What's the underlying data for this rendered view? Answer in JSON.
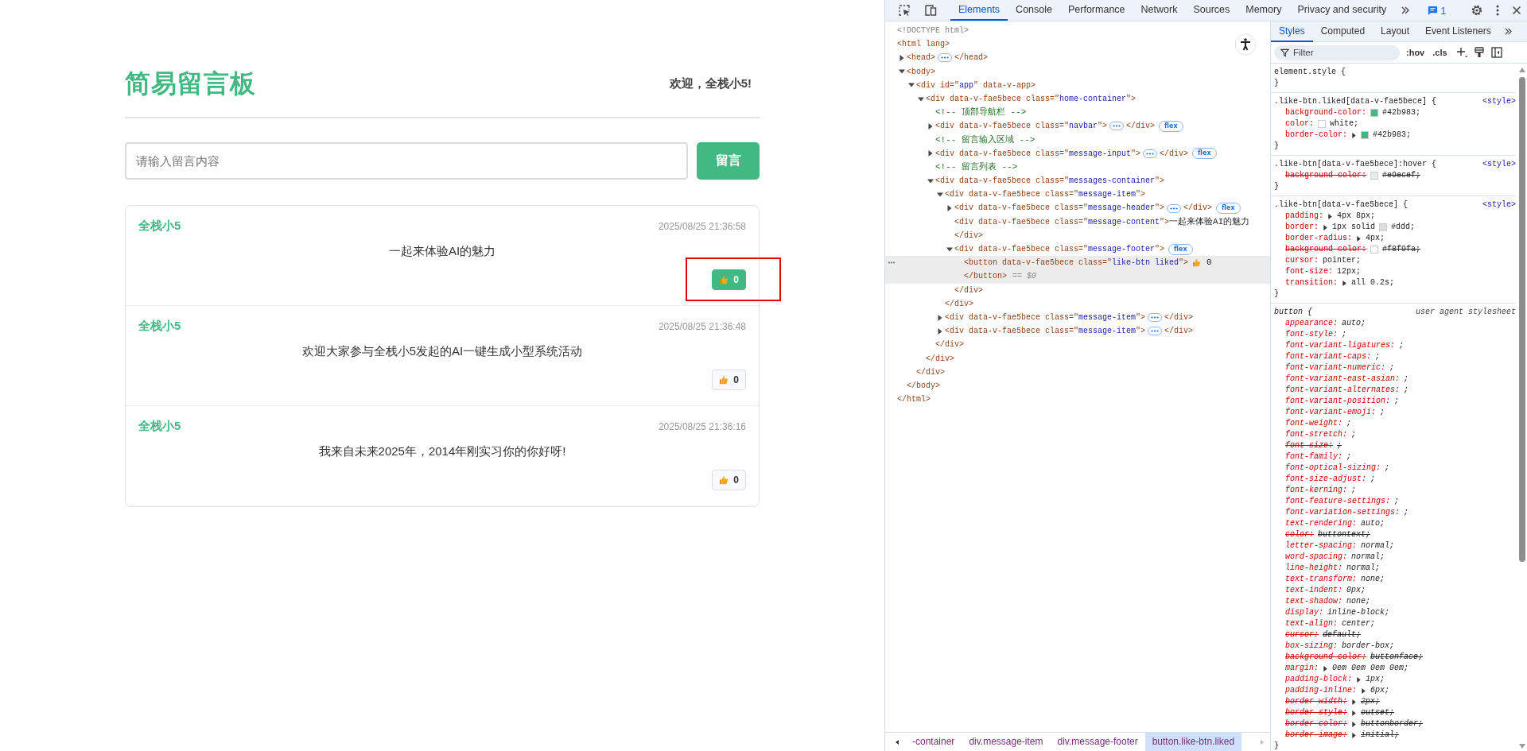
{
  "page": {
    "navbar": {
      "title": "简易留言板",
      "welcome": "欢迎，全栈小5!"
    },
    "composer": {
      "placeholder": "请输入留言内容",
      "button": "留言"
    },
    "messages": [
      {
        "author": "全栈小5",
        "time": "2025/08/25 21:36:58",
        "content": "一起来体验AI的魅力",
        "likes": "0",
        "liked": true,
        "highlighted": true
      },
      {
        "author": "全栈小5",
        "time": "2025/08/25 21:36:48",
        "content": "欢迎大家参与全栈小5发起的AI一键生成小型系统活动",
        "likes": "0",
        "liked": false,
        "highlighted": false
      },
      {
        "author": "全栈小5",
        "time": "2025/08/25 21:36:16",
        "content": "我来自未来2025年，2014年刚实习你的你好呀!",
        "likes": "0",
        "liked": false,
        "highlighted": false
      }
    ]
  },
  "devtools": {
    "tabs": [
      {
        "label": "Elements",
        "selected": true
      },
      {
        "label": "Console",
        "selected": false
      },
      {
        "label": "Performance",
        "selected": false
      },
      {
        "label": "Network",
        "selected": false
      },
      {
        "label": "Sources",
        "selected": false
      },
      {
        "label": "Memory",
        "selected": false
      },
      {
        "label": "Privacy and security",
        "selected": false
      }
    ],
    "issues_count": "1",
    "tree": [
      {
        "expandable": false,
        "selected": false,
        "tokens": [
          {
            "kind": "doctype",
            "text": "<!DOCTYPE html>"
          }
        ]
      },
      {
        "expandable": false,
        "selected": false,
        "tokens": [
          {
            "kind": "tag",
            "text": "<html lang>"
          }
        ],
        "close": "</html>",
        "children": [
          {
            "expandable": true,
            "expanded": false,
            "selected": false,
            "tokens": [
              {
                "kind": "tag",
                "text": "<head>"
              },
              {
                "kind": "ellipsis"
              },
              {
                "kind": "tag",
                "text": "</head>"
              }
            ]
          },
          {
            "expandable": true,
            "expanded": true,
            "selected": false,
            "tokens": [
              {
                "kind": "tag",
                "text": "<body>"
              }
            ],
            "close": "</body>",
            "children": [
              {
                "expandable": true,
                "expanded": true,
                "selected": false,
                "tokens": [
                  {
                    "kind": "tag",
                    "text": "<div id=\""
                  },
                  {
                    "kind": "value",
                    "text": "app"
                  },
                  {
                    "kind": "tag",
                    "text": "\" data-v-app>"
                  }
                ],
                "close": "</div>",
                "children": [
                  {
                    "expandable": true,
                    "expanded": true,
                    "selected": false,
                    "tokens": [
                      {
                        "kind": "tag",
                        "text": "<div data-v-fae5bece class=\""
                      },
                      {
                        "kind": "value",
                        "text": "home-container"
                      },
                      {
                        "kind": "tag",
                        "text": "\">"
                      }
                    ],
                    "close": "</div>",
                    "children": [
                      {
                        "expandable": false,
                        "selected": false,
                        "tokens": [
                          {
                            "kind": "comment",
                            "text": "<!-- 顶部导航栏 -->"
                          }
                        ]
                      },
                      {
                        "expandable": true,
                        "expanded": false,
                        "selected": false,
                        "tokens": [
                          {
                            "kind": "tag",
                            "text": "<div data-v-fae5bece class=\""
                          },
                          {
                            "kind": "value",
                            "text": "navbar"
                          },
                          {
                            "kind": "tag",
                            "text": "\">"
                          },
                          {
                            "kind": "ellipsis"
                          },
                          {
                            "kind": "tag",
                            "text": "</div>"
                          },
                          {
                            "kind": "badge",
                            "text": "flex"
                          }
                        ]
                      },
                      {
                        "expandable": false,
                        "selected": false,
                        "tokens": [
                          {
                            "kind": "comment",
                            "text": "<!-- 留言输入区域 -->"
                          }
                        ]
                      },
                      {
                        "expandable": true,
                        "expanded": false,
                        "selected": false,
                        "tokens": [
                          {
                            "kind": "tag",
                            "text": "<div data-v-fae5bece class=\""
                          },
                          {
                            "kind": "value",
                            "text": "message-input"
                          },
                          {
                            "kind": "tag",
                            "text": "\">"
                          },
                          {
                            "kind": "ellipsis"
                          },
                          {
                            "kind": "tag",
                            "text": "</div>"
                          },
                          {
                            "kind": "badge",
                            "text": "flex"
                          }
                        ]
                      },
                      {
                        "expandable": false,
                        "selected": false,
                        "tokens": [
                          {
                            "kind": "comment",
                            "text": "<!-- 留言列表 -->"
                          }
                        ]
                      },
                      {
                        "expandable": true,
                        "expanded": true,
                        "selected": false,
                        "tokens": [
                          {
                            "kind": "tag",
                            "text": "<div data-v-fae5bece class=\""
                          },
                          {
                            "kind": "value",
                            "text": "messages-container"
                          },
                          {
                            "kind": "tag",
                            "text": "\">"
                          }
                        ],
                        "close": "</div>",
                        "children": [
                          {
                            "expandable": true,
                            "expanded": true,
                            "selected": false,
                            "tokens": [
                              {
                                "kind": "tag",
                                "text": "<div data-v-fae5bece class=\""
                              },
                              {
                                "kind": "value",
                                "text": "message-item"
                              },
                              {
                                "kind": "tag",
                                "text": "\">"
                              }
                            ],
                            "close": "</div>",
                            "children": [
                              {
                                "expandable": true,
                                "expanded": false,
                                "selected": false,
                                "tokens": [
                                  {
                                    "kind": "tag",
                                    "text": "<div data-v-fae5bece class=\""
                                  },
                                  {
                                    "kind": "value",
                                    "text": "message-header"
                                  },
                                  {
                                    "kind": "tag",
                                    "text": "\">"
                                  },
                                  {
                                    "kind": "ellipsis"
                                  },
                                  {
                                    "kind": "tag",
                                    "text": "</div>"
                                  },
                                  {
                                    "kind": "badge",
                                    "text": "flex"
                                  }
                                ]
                              },
                              {
                                "expandable": false,
                                "selected": false,
                                "tokens": [
                                  {
                                    "kind": "tag",
                                    "text": "<div data-v-fae5bece class=\""
                                  },
                                  {
                                    "kind": "value",
                                    "text": "message-content"
                                  },
                                  {
                                    "kind": "tag",
                                    "text": "\">"
                                  },
                                  {
                                    "kind": "text",
                                    "text": "一起来体验AI的魅力"
                                  }
                                ],
                                "close": "</div>"
                              },
                              {
                                "expandable": true,
                                "expanded": true,
                                "selected": false,
                                "tokens": [
                                  {
                                    "kind": "tag",
                                    "text": "<div data-v-fae5bece class=\""
                                  },
                                  {
                                    "kind": "value",
                                    "text": "message-footer"
                                  },
                                  {
                                    "kind": "tag",
                                    "text": "\">"
                                  },
                                  {
                                    "kind": "badge",
                                    "text": "flex"
                                  }
                                ],
                                "close": "</div>",
                                "children": [
                                  {
                                    "expandable": false,
                                    "selected": true,
                                    "tokens": [
                                      {
                                        "kind": "tag",
                                        "text": "<button data-v-fae5bece class=\""
                                      },
                                      {
                                        "kind": "value",
                                        "text": "like-btn liked"
                                      },
                                      {
                                        "kind": "tag",
                                        "text": "\">"
                                      },
                                      {
                                        "kind": "thumb"
                                      },
                                      {
                                        "kind": "text",
                                        "text": "0"
                                      }
                                    ],
                                    "close": "</button>",
                                    "close_note": "== $0"
                                  }
                                ]
                              }
                            ]
                          },
                          {
                            "expandable": true,
                            "expanded": false,
                            "selected": false,
                            "tokens": [
                              {
                                "kind": "tag",
                                "text": "<div data-v-fae5bece class=\""
                              },
                              {
                                "kind": "value",
                                "text": "message-item"
                              },
                              {
                                "kind": "tag",
                                "text": "\">"
                              },
                              {
                                "kind": "ellipsis"
                              },
                              {
                                "kind": "tag",
                                "text": "</div>"
                              }
                            ]
                          },
                          {
                            "expandable": true,
                            "expanded": false,
                            "selected": false,
                            "tokens": [
                              {
                                "kind": "tag",
                                "text": "<div data-v-fae5bece class=\""
                              },
                              {
                                "kind": "value",
                                "text": "message-item"
                              },
                              {
                                "kind": "tag",
                                "text": "\">"
                              },
                              {
                                "kind": "ellipsis"
                              },
                              {
                                "kind": "tag",
                                "text": "</div>"
                              }
                            ]
                          }
                        ]
                      }
                    ]
                  }
                ]
              }
            ]
          }
        ]
      }
    ],
    "breadcrumbs": [
      {
        "label": "-container",
        "selected": false
      },
      {
        "label": "div.message-item",
        "selected": false
      },
      {
        "label": "div.message-footer",
        "selected": false
      },
      {
        "label": "button.like-btn.liked",
        "selected": true
      }
    ],
    "styles": {
      "tabs": [
        {
          "label": "Styles",
          "selected": true
        },
        {
          "label": "Computed",
          "selected": false
        },
        {
          "label": "Layout",
          "selected": false
        },
        {
          "label": "Event Listeners",
          "selected": false
        }
      ],
      "filter_placeholder": "Filter",
      "toggles": [
        ":hov",
        ".cls"
      ],
      "rules": [
        {
          "selector": "element.style {",
          "user_agent": false,
          "close": "}"
        },
        {
          "selector": ".like-btn.liked[data-v-fae5bece] {",
          "origin": "<style>",
          "user_agent": false,
          "close": "}",
          "props": [
            {
              "name": "background-color:",
              "value": "#42b983;",
              "color": "#42b983",
              "arrow": false,
              "struck": false
            },
            {
              "name": "color:",
              "value": "white;",
              "color": "#ffffff",
              "arrow": false,
              "struck": false
            },
            {
              "name": "border-color:",
              "value": "#42b983;",
              "color": "#42b983",
              "arrow": true,
              "struck": false
            }
          ]
        },
        {
          "selector": ".like-btn[data-v-fae5bece]:hover {",
          "origin": "<style>",
          "user_agent": false,
          "close": "}",
          "props": [
            {
              "name": "background-color:",
              "value": "#e9ecef;",
              "color": "#e9ecef",
              "arrow": false,
              "struck": true
            }
          ]
        },
        {
          "selector": ".like-btn[data-v-fae5bece] {",
          "origin": "<style>",
          "user_agent": false,
          "close": "}",
          "props": [
            {
              "name": "padding:",
              "value": "4px 8px;",
              "arrow": true,
              "struck": false
            },
            {
              "name": "border:",
              "prefix": "1px solid",
              "value": "#ddd;",
              "color": "#dddddd",
              "arrow": true,
              "struck": false
            },
            {
              "name": "border-radius:",
              "value": "4px;",
              "arrow": true,
              "struck": false
            },
            {
              "name": "background-color:",
              "value": "#f8f9fa;",
              "color": "#f8f9fa",
              "arrow": false,
              "struck": true
            },
            {
              "name": "cursor:",
              "value": "pointer;",
              "arrow": false,
              "struck": false
            },
            {
              "name": "font-size:",
              "value": "12px;",
              "arrow": false,
              "struck": false
            },
            {
              "name": "transition:",
              "value": "all 0.2s;",
              "arrow": true,
              "struck": false
            }
          ]
        },
        {
          "selector": "button {",
          "origin": "user agent stylesheet",
          "user_agent": true,
          "close": "}",
          "props": [
            {
              "name": "appearance:",
              "value": "auto;",
              "arrow": false,
              "struck": false
            },
            {
              "name": "font-style:",
              "value": ";",
              "arrow": false,
              "struck": false
            },
            {
              "name": "font-variant-ligatures:",
              "value": ";",
              "arrow": false,
              "struck": false
            },
            {
              "name": "font-variant-caps:",
              "value": ";",
              "arrow": false,
              "struck": false
            },
            {
              "name": "font-variant-numeric:",
              "value": ";",
              "arrow": false,
              "struck": false
            },
            {
              "name": "font-variant-east-asian:",
              "value": ";",
              "arrow": false,
              "struck": false
            },
            {
              "name": "font-variant-alternates:",
              "value": ";",
              "arrow": false,
              "struck": false
            },
            {
              "name": "font-variant-position:",
              "value": ";",
              "arrow": false,
              "struck": false
            },
            {
              "name": "font-variant-emoji:",
              "value": ";",
              "arrow": false,
              "struck": false
            },
            {
              "name": "font-weight:",
              "value": ";",
              "arrow": false,
              "struck": false
            },
            {
              "name": "font-stretch:",
              "value": ";",
              "arrow": false,
              "struck": false
            },
            {
              "name": "font-size:",
              "value": ";",
              "arrow": false,
              "struck": true
            },
            {
              "name": "font-family:",
              "value": ";",
              "arrow": false,
              "struck": false
            },
            {
              "name": "font-optical-sizing:",
              "value": ";",
              "arrow": false,
              "struck": false
            },
            {
              "name": "font-size-adjust:",
              "value": ";",
              "arrow": false,
              "struck": false
            },
            {
              "name": "font-kerning:",
              "value": ";",
              "arrow": false,
              "struck": false
            },
            {
              "name": "font-feature-settings:",
              "value": ";",
              "arrow": false,
              "struck": false
            },
            {
              "name": "font-variation-settings:",
              "value": ";",
              "arrow": false,
              "struck": false
            },
            {
              "name": "text-rendering:",
              "value": "auto;",
              "arrow": false,
              "struck": false
            },
            {
              "name": "color:",
              "value": "buttontext;",
              "arrow": false,
              "struck": true
            },
            {
              "name": "letter-spacing:",
              "value": "normal;",
              "arrow": false,
              "struck": false
            },
            {
              "name": "word-spacing:",
              "value": "normal;",
              "arrow": false,
              "struck": false
            },
            {
              "name": "line-height:",
              "value": "normal;",
              "arrow": false,
              "struck": false
            },
            {
              "name": "text-transform:",
              "value": "none;",
              "arrow": false,
              "struck": false
            },
            {
              "name": "text-indent:",
              "value": "0px;",
              "arrow": false,
              "struck": false
            },
            {
              "name": "text-shadow:",
              "value": "none;",
              "arrow": false,
              "struck": false
            },
            {
              "name": "display:",
              "value": "inline-block;",
              "arrow": false,
              "struck": false
            },
            {
              "name": "text-align:",
              "value": "center;",
              "arrow": false,
              "struck": false
            },
            {
              "name": "cursor:",
              "value": "default;",
              "arrow": false,
              "struck": true
            },
            {
              "name": "box-sizing:",
              "value": "border-box;",
              "arrow": false,
              "struck": false
            },
            {
              "name": "background-color:",
              "value": "buttonface;",
              "arrow": false,
              "struck": true
            },
            {
              "name": "margin:",
              "value": "0em 0em 0em 0em;",
              "arrow": true,
              "struck": false
            },
            {
              "name": "padding-block:",
              "value": "1px;",
              "arrow": true,
              "struck": false
            },
            {
              "name": "padding-inline:",
              "value": "6px;",
              "arrow": true,
              "struck": false
            },
            {
              "name": "border-width:",
              "value": "2px;",
              "arrow": true,
              "struck": true
            },
            {
              "name": "border-style:",
              "value": "outset;",
              "arrow": true,
              "struck": true
            },
            {
              "name": "border-color:",
              "value": "buttonborder;",
              "arrow": true,
              "struck": true
            },
            {
              "name": "border-image:",
              "value": "initial;",
              "arrow": true,
              "struck": true
            }
          ]
        }
      ]
    }
  }
}
